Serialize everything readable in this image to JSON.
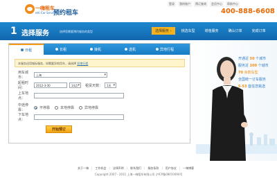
{
  "header": {
    "logo_cn": "一嗨租车",
    "logo_en": "eHi Car Service",
    "title": "预约租车",
    "utility_links": [
      "登录",
      "我的账户",
      "预订查询",
      "会员中心",
      "帮助中心"
    ],
    "hotline": "400-888-6608"
  },
  "service_bar": {
    "step_number": "1",
    "title": "选择服务",
    "hint": "选择您需要预约服务的类型",
    "steps": [
      {
        "label": "选择服务 ›",
        "active": true
      },
      {
        "label": "挑选车型",
        "active": false
      },
      {
        "label": "增值服务",
        "active": false
      },
      {
        "label": "确认订单",
        "active": false
      },
      {
        "label": "完成订单",
        "active": false
      }
    ]
  },
  "tabs": [
    {
      "label": "日租",
      "icon": "car-icon",
      "active": true
    },
    {
      "label": "长租",
      "icon": "car-icon",
      "active": false
    },
    {
      "label": "接机",
      "icon": "plane-icon",
      "active": false
    },
    {
      "label": "送机",
      "icon": "plane-icon",
      "active": false
    },
    {
      "label": "异地行程",
      "icon": "route-icon",
      "active": false
    }
  ],
  "notice": {
    "text": "本服务适用城际服务，如需要异地用车，请选择",
    "link": "异地行程"
  },
  "form": {
    "city_label": "用车城市：",
    "city_value": "上海",
    "start_label": "起租时间：",
    "start_date": "2012-3-30",
    "start_hour": "14点",
    "days_label": "租赁天数：",
    "days_value": "1天",
    "pickup_label": "上车地点：",
    "pickup_value": "",
    "via_label": "中途停靠：",
    "via_options": [
      "不停靠",
      "本地停靠",
      "异地停靠"
    ],
    "dropoff_label": "下车地点：",
    "dropoff_value": "",
    "submit_label": "开始预订"
  },
  "hero": {
    "stats": [
      {
        "prefix": "开通近",
        "num": "50",
        "suffix": "个城市"
      },
      {
        "prefix": "服务近",
        "num": "200",
        "suffix": "个城市"
      },
      {
        "prefix": "",
        "num": "70",
        "suffix": "余款车型"
      },
      {
        "prefix": "",
        "num": "",
        "suffix": "全国统一订车服务"
      },
      {
        "prefix": "",
        "num": "5-53",
        "suffix": "座任您挑选"
      }
    ]
  },
  "footer": {
    "links": [
      "关于一嗨",
      "工作机会",
      "法律声明",
      "联系我们",
      "服务条款",
      "用户协议",
      "一嗨博客"
    ],
    "copyright": "Copyright 2007 - 2011 上海一嗨租车有限公司 沪ICP备08010094号"
  },
  "colors": {
    "brand_blue": "#1e88cf",
    "brand_orange": "#f28f12",
    "notice_bg": "#fff5cc"
  }
}
